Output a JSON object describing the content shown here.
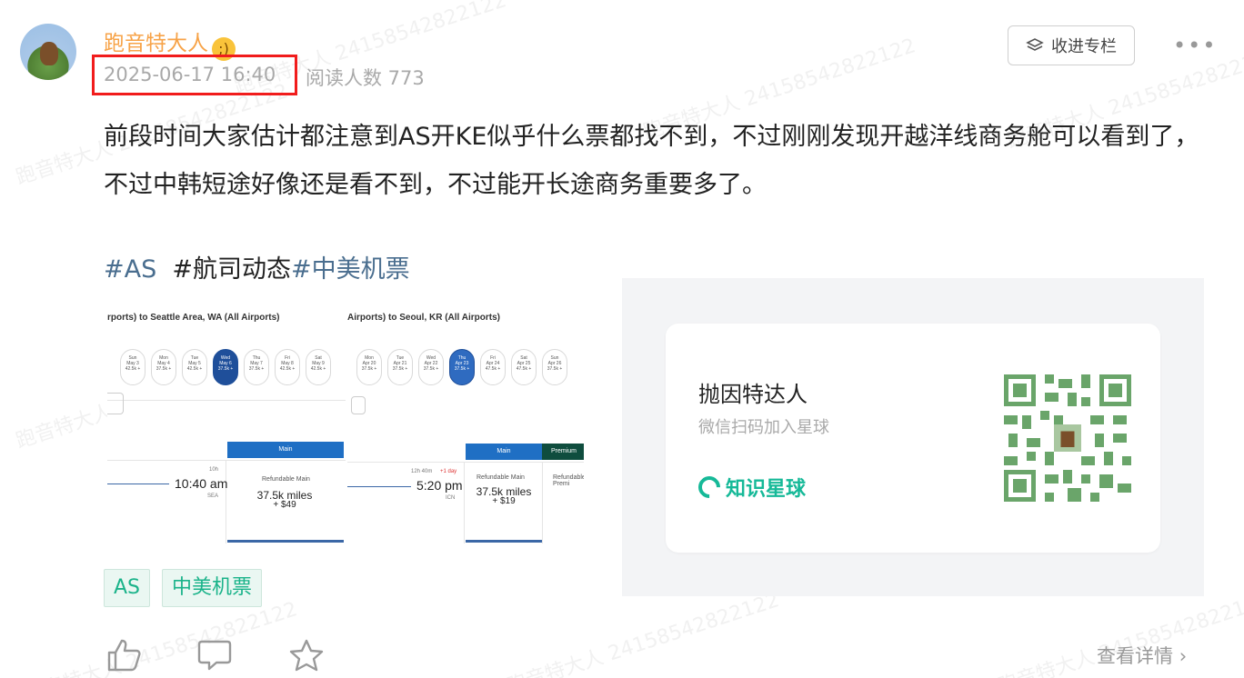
{
  "post": {
    "author": "跑音特大人",
    "emoji": ";)",
    "date": "2025-06-17 16:40",
    "reads": "阅读人数 773",
    "collect_label": "收进专栏",
    "more_label": "•••",
    "body": "前段时间大家估计都注意到AS开KE似乎什么票都找不到，不过刚刚发现开越洋线商务舱可以看到了，不过中韩短途好像还是看不到，不过能开长途商务重要多了。",
    "hashtags": [
      "#AS",
      "#航司动态",
      "#中美机票"
    ],
    "tags": [
      "AS",
      "中美机票"
    ],
    "detail_label": "查看详情"
  },
  "screenshot": {
    "left": {
      "route": "rports) to Seattle Area, WA (All Airports)",
      "days": [
        {
          "d": "Sun",
          "date": "May 3",
          "price": "42.5k +"
        },
        {
          "d": "Mon",
          "date": "May 4",
          "price": "37.5k +"
        },
        {
          "d": "Tue",
          "date": "May 5",
          "price": "42.5k +"
        },
        {
          "d": "Wed",
          "date": "May 6",
          "price": "37.5k +"
        },
        {
          "d": "Thu",
          "date": "May 7",
          "price": "37.5k +"
        },
        {
          "d": "Fri",
          "date": "May 8",
          "price": "42.5k +"
        },
        {
          "d": "Sat",
          "date": "May 9",
          "price": "42.5k +"
        }
      ],
      "tab_main": "Main",
      "duration": "10h",
      "time": "10:40 am",
      "airport": "SEA",
      "fare_label": "Refundable Main",
      "miles": "37.5k miles",
      "fee": "+ $49"
    },
    "right": {
      "route": "Airports) to Seoul, KR (All Airports)",
      "days": [
        {
          "d": "Mon",
          "date": "Apr 20",
          "price": "37.5k +"
        },
        {
          "d": "Tue",
          "date": "Apr 21",
          "price": "37.5k +"
        },
        {
          "d": "Wed",
          "date": "Apr 22",
          "price": "37.5k +"
        },
        {
          "d": "Thu",
          "date": "Apr 23",
          "price": "37.5k +"
        },
        {
          "d": "Fri",
          "date": "Apr 24",
          "price": "47.5k +"
        },
        {
          "d": "Sat",
          "date": "Apr 25",
          "price": "47.5k +"
        },
        {
          "d": "Sun",
          "date": "Apr 26",
          "price": "37.5k +"
        }
      ],
      "tab_main": "Main",
      "tab_premium": "Premium",
      "duration": "12h 40m",
      "plus_day": "+1 day",
      "time": "5:20 pm",
      "airport": "ICN",
      "fare_label": "Refundable Main",
      "fare_label2": "Refundable Premi",
      "miles": "37.5k miles",
      "fee": "+ $19"
    }
  },
  "planet": {
    "name": "抛因特达人",
    "hint": "微信扫码加入星球",
    "brand": "知识星球"
  },
  "watermark": "跑音特大人 24158542822122",
  "colors": {
    "accent_orange": "#f7a348",
    "highlight_red": "#f11c1c",
    "hashtag_blue": "#4a6e8f",
    "tag_green": "#1ab38a",
    "qr_green": "#6aa56a"
  }
}
